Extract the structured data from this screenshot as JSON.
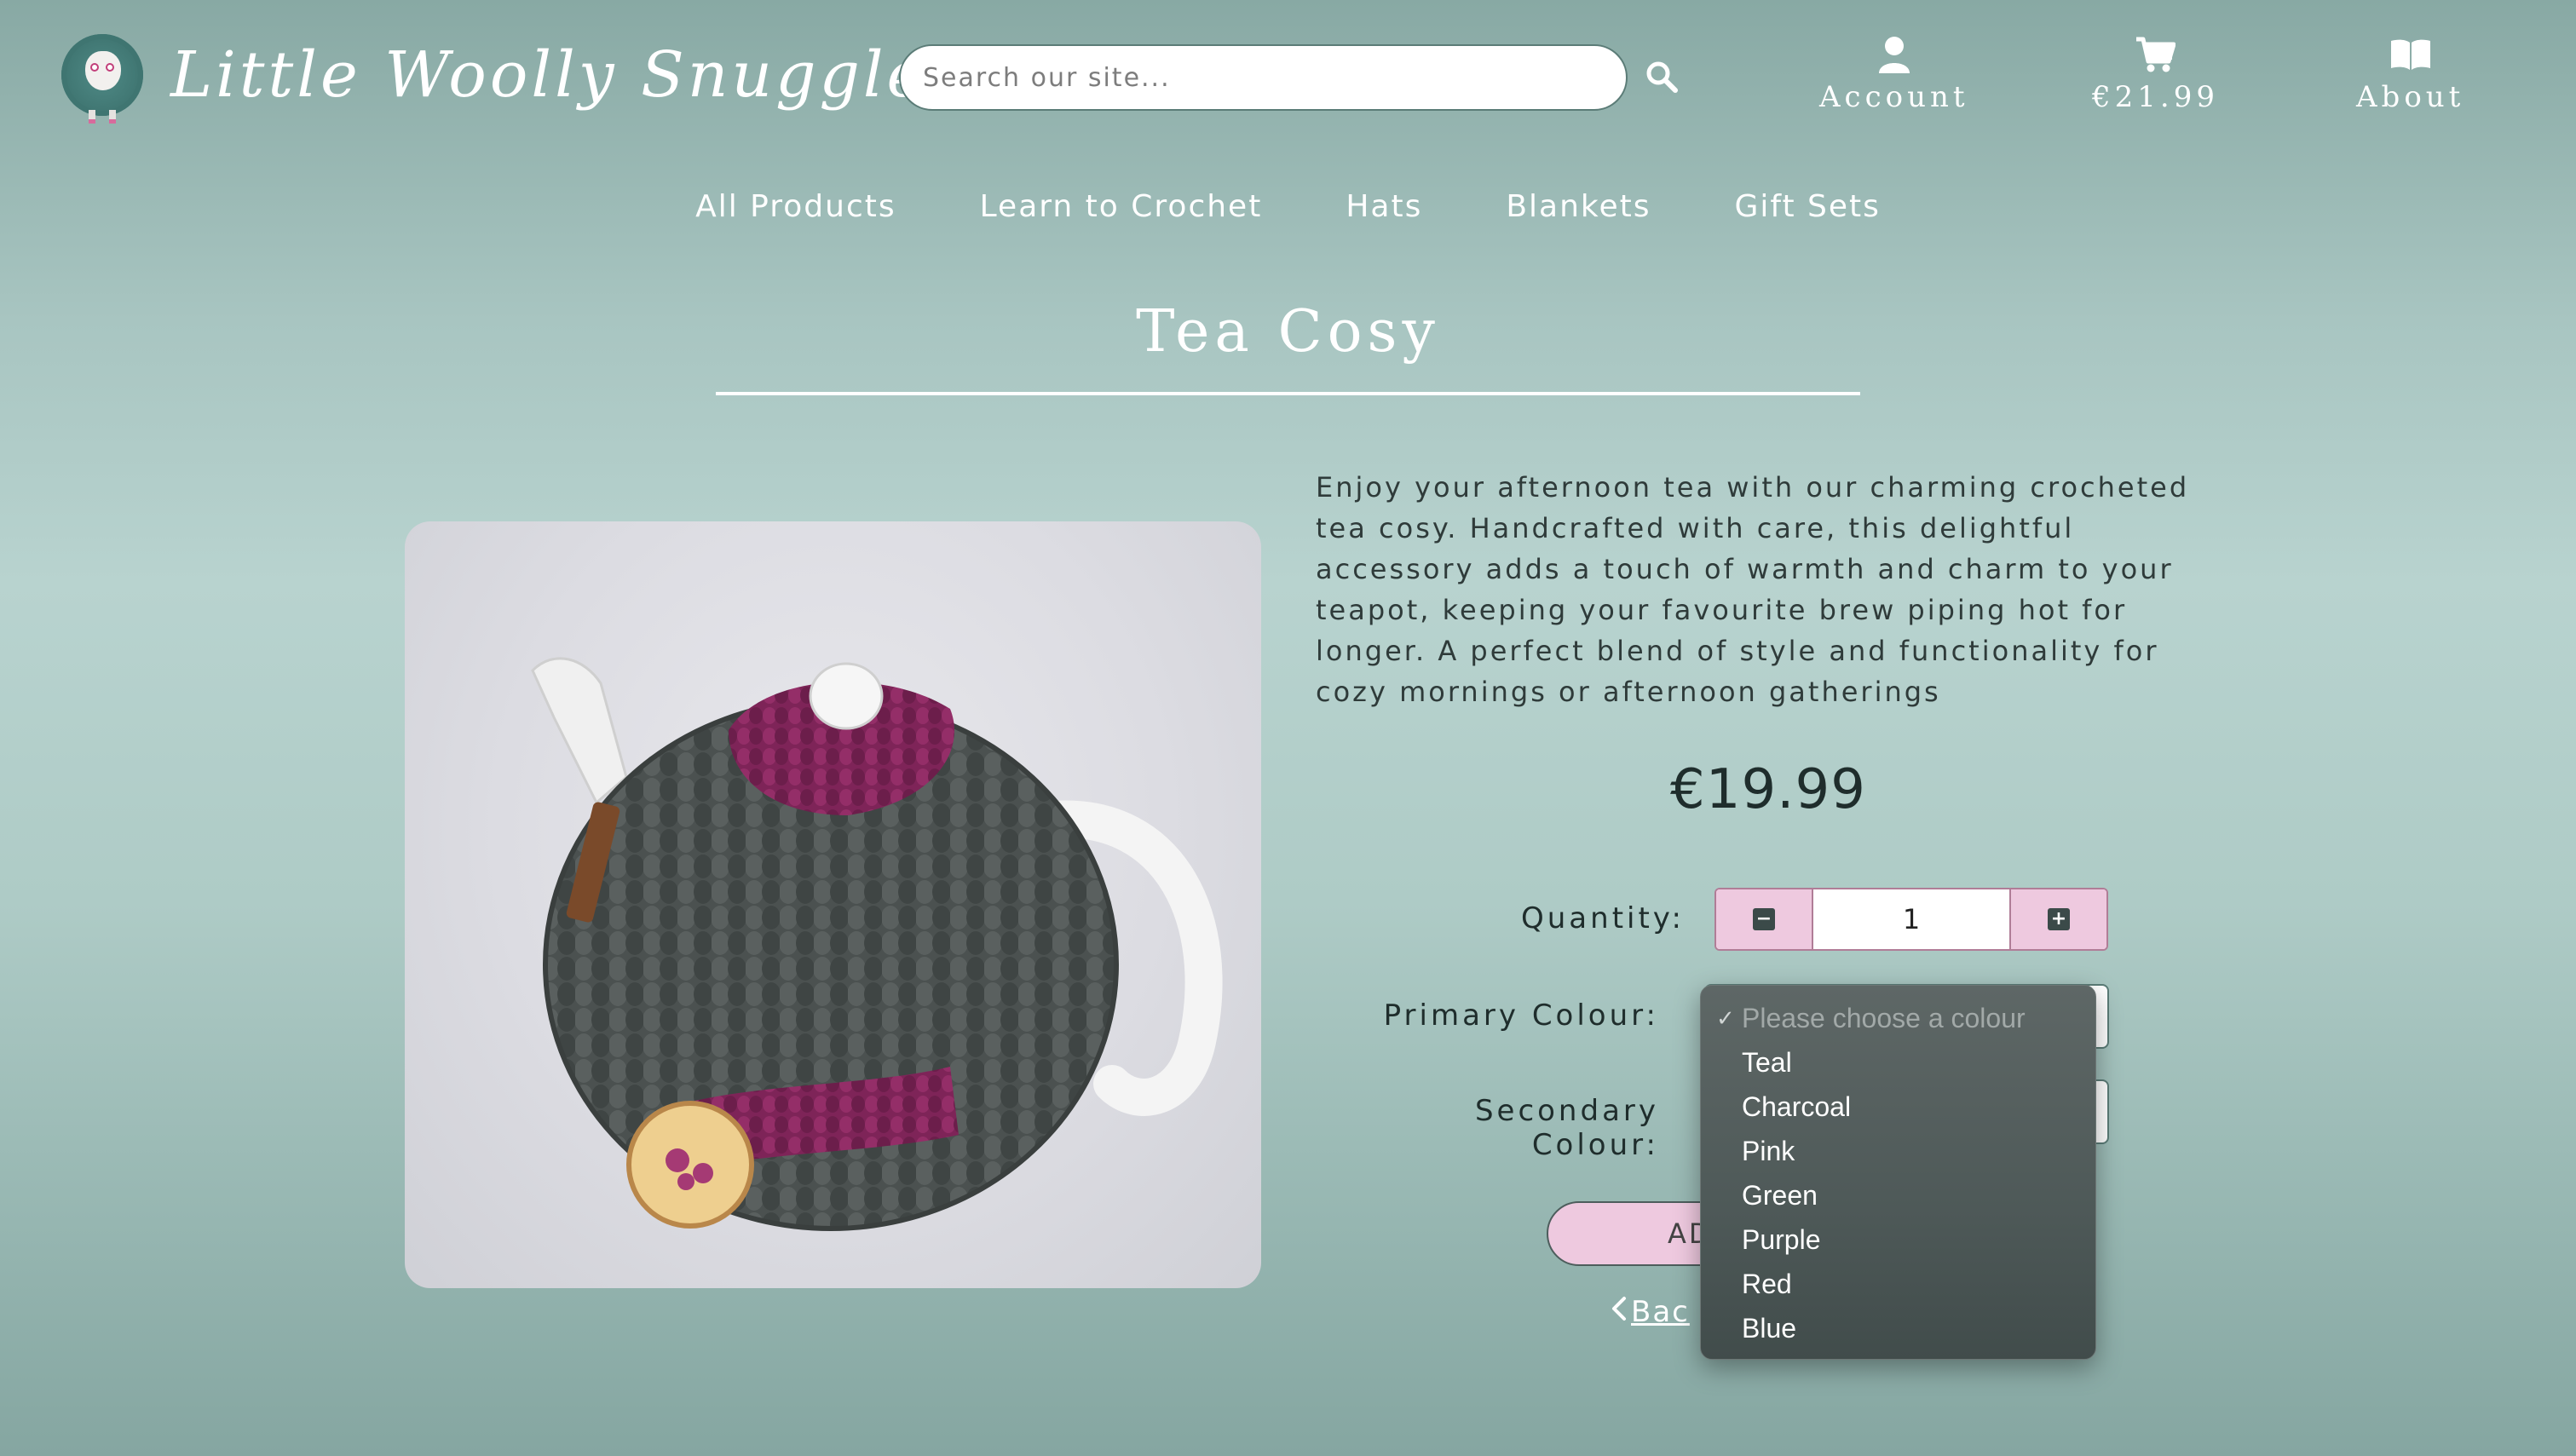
{
  "header": {
    "logo_text": "Little Woolly Snuggles",
    "search_placeholder": "Search our site...",
    "account_label": "Account",
    "cart_label": "€21.99",
    "about_label": "About"
  },
  "nav": [
    "All Products",
    "Learn to Crochet",
    "Hats",
    "Blankets",
    "Gift Sets"
  ],
  "product": {
    "title": "Tea Cosy",
    "description": "Enjoy your afternoon tea with our charming crocheted tea cosy. Handcrafted with care, this delightful accessory adds a touch of warmth and charm to your teapot, keeping your favourite brew piping hot for longer. A perfect blend of style and functionality for cozy mornings or afternoon gatherings",
    "price": "€19.99",
    "quantity_label": "Quantity:",
    "quantity_value": "1",
    "primary_colour_label": "Primary Colour:",
    "secondary_colour_label": "Secondary Colour:",
    "add_button_label": "AD",
    "back_link_label": "Bac"
  },
  "dropdown": {
    "placeholder": "Please choose a colour",
    "options": [
      "Teal",
      "Charcoal",
      "Pink",
      "Green",
      "Purple",
      "Red",
      "Blue"
    ]
  },
  "colors": {
    "accent_pink": "#eec9df",
    "dark_text": "#1f2d2c",
    "teal": "#3f7571"
  }
}
